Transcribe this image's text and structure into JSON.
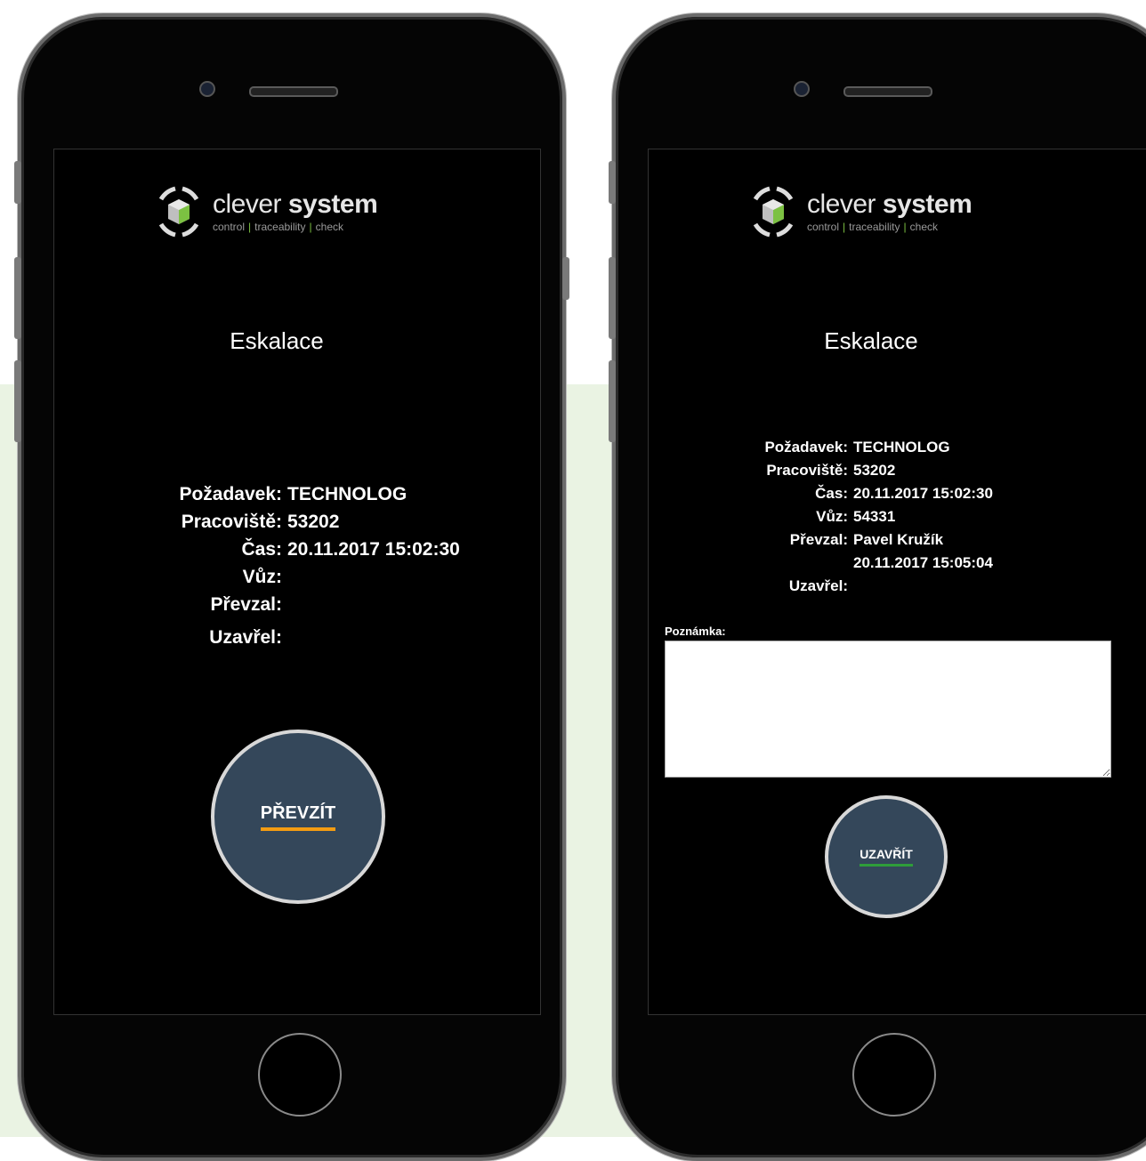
{
  "brand": {
    "name_light": "clever",
    "name_bold": "system",
    "tagline": [
      "control",
      "traceability",
      "check"
    ],
    "accent_color": "#7cc142",
    "logo_icon": "cube-in-brackets-icon"
  },
  "left": {
    "title": "Eskalace",
    "fields": [
      {
        "label": "Požadavek:",
        "value": "TECHNOLOG"
      },
      {
        "label": "Pracoviště:",
        "value": "53202"
      },
      {
        "label": "Čas:",
        "value": "20.11.2017 15:02:30"
      },
      {
        "label": "Vůz:",
        "value": ""
      },
      {
        "label": "Převzal:",
        "value": ""
      },
      {
        "label": "Uzavřel:",
        "value": ""
      }
    ],
    "action_button": "PŘEVZÍT",
    "action_underline_color": "#f39c12"
  },
  "right": {
    "title": "Eskalace",
    "fields": [
      {
        "label": "Požadavek:",
        "value": "TECHNOLOG"
      },
      {
        "label": "Pracoviště:",
        "value": "53202"
      },
      {
        "label": "Čas:",
        "value": "20.11.2017 15:02:30"
      },
      {
        "label": "Vůz:",
        "value": "54331"
      },
      {
        "label": "Převzal:",
        "value": "Pavel Kružík"
      },
      {
        "label": "",
        "value": "20.11.2017 15:05:04"
      },
      {
        "label": "Uzavřel:",
        "value": ""
      }
    ],
    "note_label": "Poznámka:",
    "note_value": "",
    "action_button": "UZAVŘÍT",
    "action_underline_color": "#2e9d3a"
  }
}
